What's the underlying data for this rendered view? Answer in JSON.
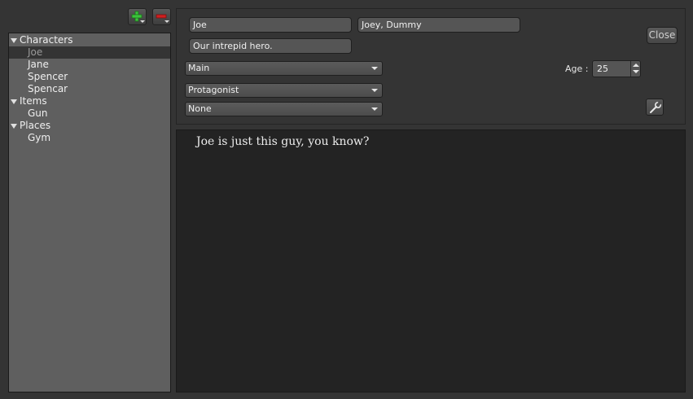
{
  "toolbar": {
    "add_icon": "plus-icon",
    "remove_icon": "minus-icon"
  },
  "tree": {
    "categories": [
      {
        "label": "Characters",
        "children": [
          "Joe",
          "Jane",
          "Spencer",
          "Spencar"
        ]
      },
      {
        "label": "Items",
        "children": [
          "Gun"
        ]
      },
      {
        "label": "Places",
        "children": [
          "Gym"
        ]
      }
    ],
    "selected": "Joe"
  },
  "form": {
    "name": "Joe",
    "aliases": "Joey, Dummy",
    "description": "Our intrepid hero.",
    "importance": "Main",
    "role": "Protagonist",
    "extra": "None",
    "age_label": "Age :",
    "age_value": "25",
    "close_label": "Close"
  },
  "editor": {
    "text": "Joe is just this guy, you know?"
  },
  "colors": {
    "add_green": "#3cc33c",
    "remove_red": "#d02020",
    "background": "#343434",
    "tree_bg": "#5f5f5f",
    "editor_bg": "#232323"
  }
}
